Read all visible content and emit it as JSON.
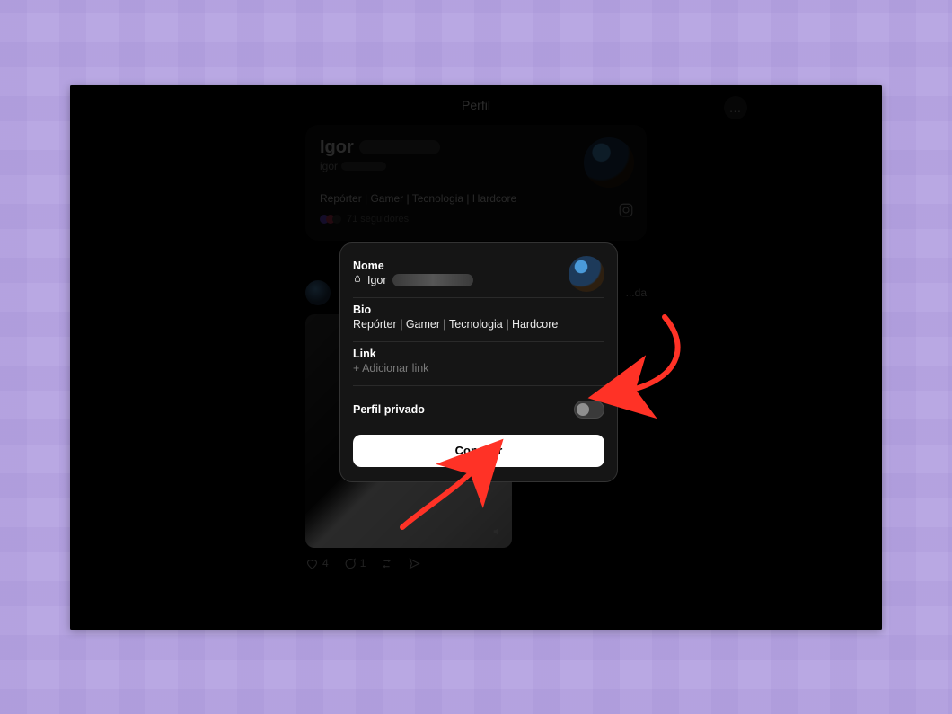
{
  "colors": {
    "accent_arrow": "#ff3226",
    "modal_bg": "#151515",
    "done_bg": "#ffffff"
  },
  "header": {
    "title": "Perfil",
    "menu_icon": "…"
  },
  "profile": {
    "name_visible": "Igor",
    "handle_prefix": "igor",
    "bio": "Repórter | Gamer | Tecnologia | Hardcore",
    "followers_text": "71 seguidores",
    "external_icon": "instagram"
  },
  "post": {
    "handle_suffix": "...da",
    "likes": "4",
    "comments": "1",
    "sound_icon": "speaker-muted"
  },
  "modal": {
    "avatar": "user-avatar",
    "name": {
      "label": "Nome",
      "lock_icon": "lock",
      "value_visible": "Igor"
    },
    "bio": {
      "label": "Bio",
      "value": "Repórter | Gamer | Tecnologia | Hardcore"
    },
    "link": {
      "label": "Link",
      "placeholder": "+ Adicionar link"
    },
    "private": {
      "label": "Perfil privado",
      "state": "off"
    },
    "done_label": "Concluir"
  }
}
